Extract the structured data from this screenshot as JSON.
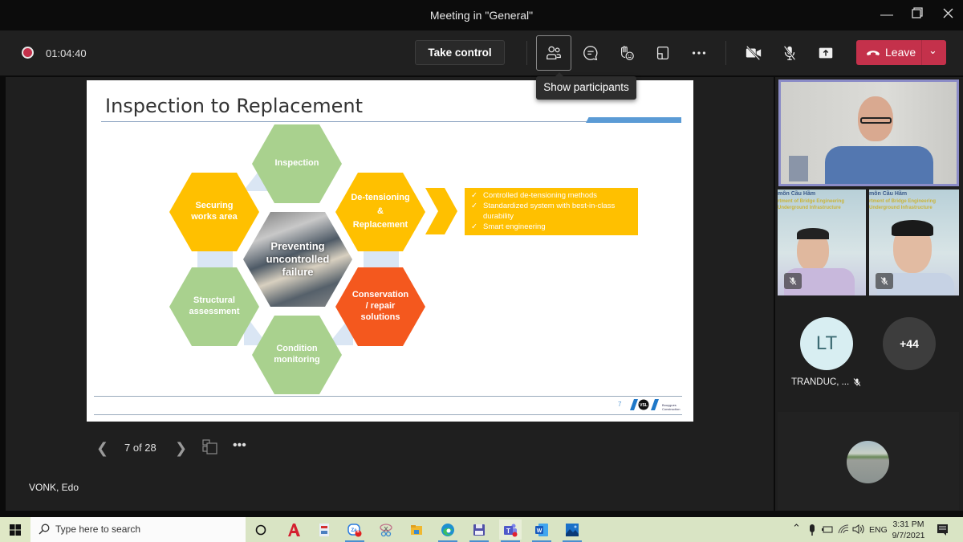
{
  "window": {
    "title": "Meeting in \"General\"",
    "controls": [
      "minimize",
      "restore",
      "close"
    ]
  },
  "toolbar": {
    "recording_icon": "record-icon",
    "elapsed_time": "01:04:40",
    "take_control_label": "Take control",
    "buttons": [
      {
        "name": "participants",
        "icon": "people-icon",
        "active": true
      },
      {
        "name": "chat",
        "icon": "chat-icon"
      },
      {
        "name": "reactions",
        "icon": "raise-hand-icon"
      },
      {
        "name": "rooms",
        "icon": "rooms-icon"
      },
      {
        "name": "more",
        "icon": "more-icon"
      },
      {
        "name": "camera",
        "icon": "camera-off-icon"
      },
      {
        "name": "mic",
        "icon": "mic-off-icon"
      },
      {
        "name": "share",
        "icon": "share-icon"
      }
    ],
    "leave_label": "Leave",
    "tooltip": "Show participants"
  },
  "slide": {
    "title": "Inspection to Replacement",
    "center": "Preventing uncontrolled failure",
    "hexagons": [
      {
        "label": "Inspection",
        "color": "green"
      },
      {
        "label": "De-tensioning & Replacement",
        "color": "yellow"
      },
      {
        "label": "Conservation / repair solutions",
        "color": "orange"
      },
      {
        "label": "Condition monitoring",
        "color": "green"
      },
      {
        "label": "Structural assessment",
        "color": "green"
      },
      {
        "label": "Securing works area",
        "color": "yellow"
      }
    ],
    "hex_lines": {
      "inspection": [
        "Inspection"
      ],
      "detension": [
        "De-tensioning",
        "&",
        "Replacement"
      ],
      "conservation": [
        "Conservation",
        "/ repair",
        "solutions"
      ],
      "condition": [
        "Condition",
        "monitoring"
      ],
      "structural": [
        "Structural",
        "assessment"
      ],
      "securing": [
        "Securing",
        "works area"
      ],
      "center": [
        "Preventing",
        "uncontrolled",
        "failure"
      ]
    },
    "bullets": [
      "Controlled de-tensioning methods",
      "Standardized system with best-in-class durability",
      "Smart engineering"
    ],
    "page_number": "7",
    "logo_text": "VSL",
    "logo_subtext": "Bouygues Construction"
  },
  "colors": {
    "green": "#a9d18e",
    "yellow": "#ffc000",
    "orange": "#f4581e",
    "leave_red": "#c4314b",
    "accent_blue": "#5b9bd5"
  },
  "presentation": {
    "page_indicator": "7 of 28",
    "presenter_name": "VONK, Edo"
  },
  "participants": {
    "video_banner_line1": "môn Cầu Hầm",
    "video_banner_line2": "rtment of Bridge Engineering",
    "video_banner_line3": "Underground Infrastructure",
    "avatar_initials": "LT",
    "avatar_name": "TRANDUC, ...",
    "overflow_count": "+44"
  },
  "taskbar": {
    "search_placeholder": "Type here to search",
    "zalo_badge": "1",
    "apps": [
      "cortana",
      "autocad",
      "pdf-reader",
      "zalo",
      "snipping",
      "file-explorer",
      "edge",
      "save",
      "teams",
      "word",
      "photos"
    ],
    "language": "ENG",
    "time": "3:31 PM",
    "date": "9/7/2021"
  }
}
